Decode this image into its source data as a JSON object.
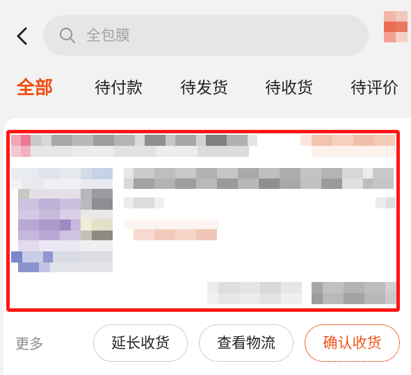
{
  "header": {
    "back_icon": "chevron-left-icon",
    "search": {
      "icon": "search-icon",
      "value": "",
      "placeholder": "全包膜"
    }
  },
  "tabs": [
    {
      "label": "全部",
      "active": true
    },
    {
      "label": "待付款",
      "active": false
    },
    {
      "label": "待发货",
      "active": false
    },
    {
      "label": "待收货",
      "active": false
    },
    {
      "label": "待评价",
      "active": false
    }
  ],
  "order_card": {
    "content_state": "pixelated"
  },
  "actions": {
    "more_label": "更多",
    "buttons": [
      {
        "label": "延长收货",
        "primary": false
      },
      {
        "label": "查看物流",
        "primary": false
      },
      {
        "label": "确认收货",
        "primary": true
      }
    ]
  },
  "colors": {
    "accent": "#f04d12",
    "highlight_border": "#ff1616",
    "page_background": "#f2f2f2",
    "card_background": "#ffffff",
    "muted_text": "#8a8a8a"
  }
}
